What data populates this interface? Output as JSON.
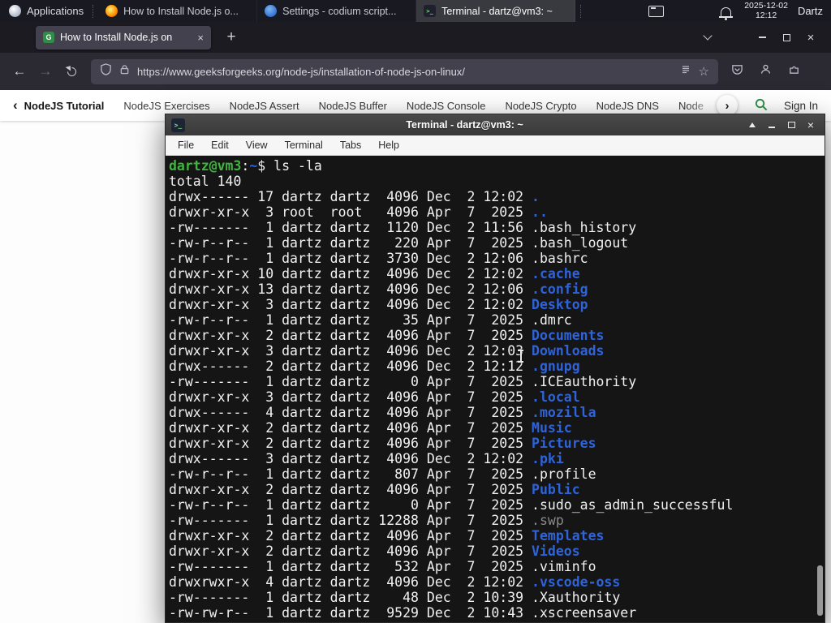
{
  "colors": {
    "accent_green": "#2f8d46",
    "terminal_dir": "#2e63d9",
    "terminal_dim": "#8a8a8a",
    "prompt_user_green": "#3fb53f",
    "prompt_path_blue": "#2e63d9"
  },
  "panel": {
    "applications_label": "Applications",
    "tasks": [
      {
        "label": "How to Install Node.js o...",
        "icon": "firefox",
        "active": false
      },
      {
        "label": "Settings - codium script...",
        "icon": "settings",
        "active": false
      },
      {
        "label": "Terminal - dartz@vm3: ~",
        "icon": "terminal",
        "active": true
      }
    ],
    "clock_date": "2025-12-02",
    "clock_time": "12:12",
    "user_label": "Dartz"
  },
  "browser": {
    "tab_title": "How to Install Node.js on",
    "url": "https://www.geeksforgeeks.org/node-js/installation-of-node-js-on-linux/"
  },
  "site_nav": {
    "items": [
      "NodeJS Tutorial",
      "NodeJS Exercises",
      "NodeJS Assert",
      "NodeJS Buffer",
      "NodeJS Console",
      "NodeJS Crypto",
      "NodeJS DNS",
      "Node"
    ],
    "sign_in_label": "Sign In"
  },
  "terminal": {
    "title": "Terminal - dartz@vm3: ~",
    "menu": [
      "File",
      "Edit",
      "View",
      "Terminal",
      "Tabs",
      "Help"
    ],
    "prompt": {
      "user": "dartz@vm3",
      "separator": ":",
      "path": "~",
      "symbol": "$ ",
      "command": "ls -la"
    },
    "output": [
      {
        "pre": "total 140",
        "name": "",
        "kind": "plain"
      },
      {
        "pre": "drwx------ 17 dartz dartz  4096 Dec  2 12:02 ",
        "name": ".",
        "kind": "dir"
      },
      {
        "pre": "drwxr-xr-x  3 root  root   4096 Apr  7  2025 ",
        "name": "..",
        "kind": "dir"
      },
      {
        "pre": "-rw-------  1 dartz dartz  1120 Dec  2 11:56 ",
        "name": ".bash_history",
        "kind": "file"
      },
      {
        "pre": "-rw-r--r--  1 dartz dartz   220 Apr  7  2025 ",
        "name": ".bash_logout",
        "kind": "file"
      },
      {
        "pre": "-rw-r--r--  1 dartz dartz  3730 Dec  2 12:06 ",
        "name": ".bashrc",
        "kind": "file"
      },
      {
        "pre": "drwxr-xr-x 10 dartz dartz  4096 Dec  2 12:02 ",
        "name": ".cache",
        "kind": "dir"
      },
      {
        "pre": "drwxr-xr-x 13 dartz dartz  4096 Dec  2 12:06 ",
        "name": ".config",
        "kind": "dir"
      },
      {
        "pre": "drwxr-xr-x  3 dartz dartz  4096 Dec  2 12:02 ",
        "name": "Desktop",
        "kind": "dir"
      },
      {
        "pre": "-rw-r--r--  1 dartz dartz    35 Apr  7  2025 ",
        "name": ".dmrc",
        "kind": "file"
      },
      {
        "pre": "drwxr-xr-x  2 dartz dartz  4096 Apr  7  2025 ",
        "name": "Documents",
        "kind": "dir"
      },
      {
        "pre": "drwxr-xr-x  3 dartz dartz  4096 Dec  2 12:03 ",
        "name": "Downloads",
        "kind": "dir"
      },
      {
        "pre": "drwx------  2 dartz dartz  4096 Dec  2 12:12 ",
        "name": ".gnupg",
        "kind": "dir"
      },
      {
        "pre": "-rw-------  1 dartz dartz     0 Apr  7  2025 ",
        "name": ".ICEauthority",
        "kind": "file"
      },
      {
        "pre": "drwxr-xr-x  3 dartz dartz  4096 Apr  7  2025 ",
        "name": ".local",
        "kind": "dir"
      },
      {
        "pre": "drwx------  4 dartz dartz  4096 Apr  7  2025 ",
        "name": ".mozilla",
        "kind": "dir"
      },
      {
        "pre": "drwxr-xr-x  2 dartz dartz  4096 Apr  7  2025 ",
        "name": "Music",
        "kind": "dir"
      },
      {
        "pre": "drwxr-xr-x  2 dartz dartz  4096 Apr  7  2025 ",
        "name": "Pictures",
        "kind": "dir"
      },
      {
        "pre": "drwx------  3 dartz dartz  4096 Dec  2 12:02 ",
        "name": ".pki",
        "kind": "dir"
      },
      {
        "pre": "-rw-r--r--  1 dartz dartz   807 Apr  7  2025 ",
        "name": ".profile",
        "kind": "file"
      },
      {
        "pre": "drwxr-xr-x  2 dartz dartz  4096 Apr  7  2025 ",
        "name": "Public",
        "kind": "dir"
      },
      {
        "pre": "-rw-r--r--  1 dartz dartz     0 Apr  7  2025 ",
        "name": ".sudo_as_admin_successful",
        "kind": "file"
      },
      {
        "pre": "-rw-------  1 dartz dartz 12288 Apr  7  2025 ",
        "name": ".swp",
        "kind": "dim"
      },
      {
        "pre": "drwxr-xr-x  2 dartz dartz  4096 Apr  7  2025 ",
        "name": "Templates",
        "kind": "dir"
      },
      {
        "pre": "drwxr-xr-x  2 dartz dartz  4096 Apr  7  2025 ",
        "name": "Videos",
        "kind": "dir"
      },
      {
        "pre": "-rw-------  1 dartz dartz   532 Apr  7  2025 ",
        "name": ".viminfo",
        "kind": "file"
      },
      {
        "pre": "drwxrwxr-x  4 dartz dartz  4096 Dec  2 12:02 ",
        "name": ".vscode-oss",
        "kind": "dir"
      },
      {
        "pre": "-rw-------  1 dartz dartz    48 Dec  2 10:39 ",
        "name": ".Xauthority",
        "kind": "file"
      },
      {
        "pre": "-rw-rw-r--  1 dartz dartz  9529 Dec  2 10:43 ",
        "name": ".xscreensaver",
        "kind": "file"
      }
    ]
  }
}
